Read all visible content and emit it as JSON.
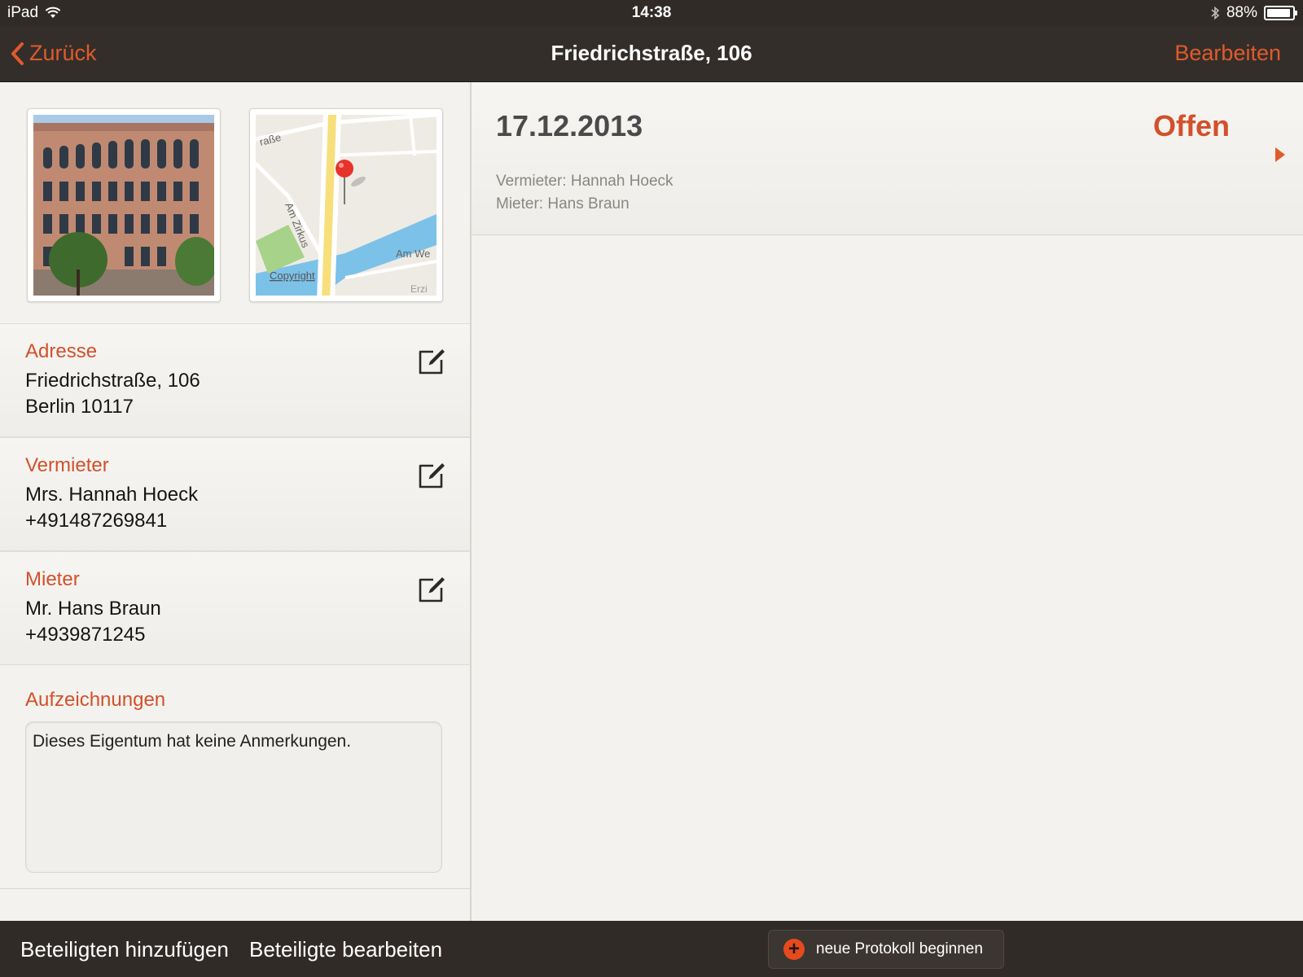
{
  "statusbar": {
    "device": "iPad",
    "time": "14:38",
    "battery": "88%",
    "battery_level": 0.88
  },
  "navbar": {
    "back_label": "Zurück",
    "title": "Friedrichstraße, 106",
    "edit_label": "Bearbeiten"
  },
  "map": {
    "street_top": "raße",
    "street_am_zirkus": "Am Zirkus",
    "street_am_we": "Am We",
    "street_erzi": "Erzi",
    "copyright": "Copyright"
  },
  "address": {
    "label": "Adresse",
    "line1": "Friedrichstraße, 106",
    "line2": "Berlin 10117"
  },
  "landlord": {
    "label": "Vermieter",
    "line1": "Mrs. Hannah Hoeck",
    "line2": "+491487269841"
  },
  "tenant": {
    "label": "Mieter",
    "line1": "Mr. Hans Braun",
    "line2": "+4939871245"
  },
  "notes": {
    "label": "Aufzeichnungen",
    "text": "Dieses Eigentum hat keine Anmerkungen."
  },
  "protocol": {
    "date": "17.12.2013",
    "status": "Offen",
    "landlord": "Vermieter: Hannah Hoeck",
    "tenant": "Mieter: Hans Braun"
  },
  "toolbar": {
    "add_participant": "Beteiligten hinzufügen",
    "edit_participants": "Beteiligte bearbeiten",
    "new_protocol": "neue Protokoll beginnen"
  },
  "colors": {
    "accent": "#d2502a",
    "bar": "#302b27",
    "background": "#f4f2ee"
  }
}
